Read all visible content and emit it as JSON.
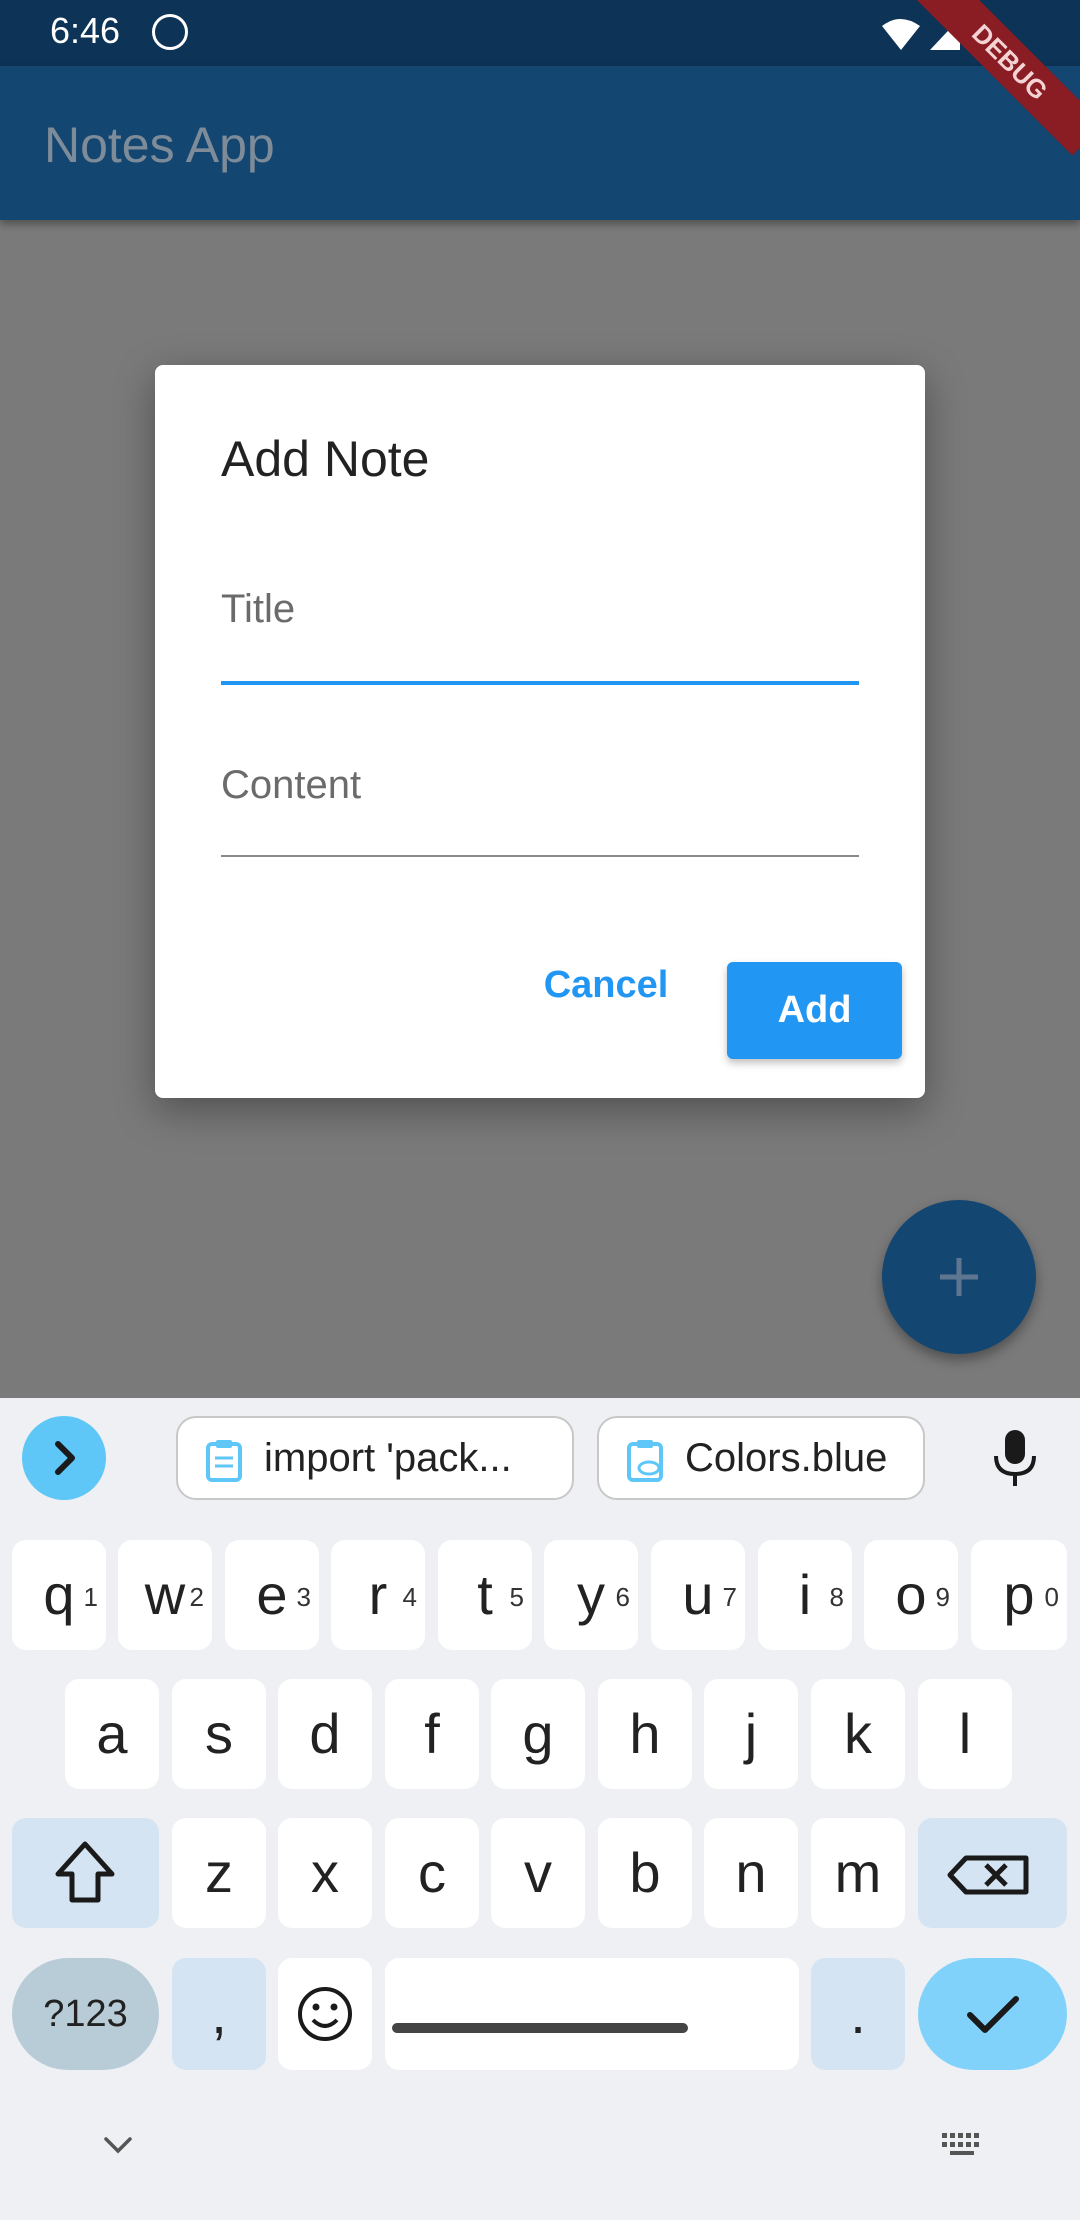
{
  "status": {
    "time": "6:46"
  },
  "appbar": {
    "title": "Notes App",
    "debug": "DEBUG"
  },
  "dialog": {
    "title": "Add Note",
    "title_placeholder": "Title",
    "content_placeholder": "Content",
    "cancel": "Cancel",
    "add": "Add"
  },
  "fab": {
    "icon": "plus-icon"
  },
  "keyboard": {
    "suggestions": [
      "import 'pack...",
      "Colors.blue"
    ],
    "row1": [
      {
        "k": "q",
        "n": "1"
      },
      {
        "k": "w",
        "n": "2"
      },
      {
        "k": "e",
        "n": "3"
      },
      {
        "k": "r",
        "n": "4"
      },
      {
        "k": "t",
        "n": "5"
      },
      {
        "k": "y",
        "n": "6"
      },
      {
        "k": "u",
        "n": "7"
      },
      {
        "k": "i",
        "n": "8"
      },
      {
        "k": "o",
        "n": "9"
      },
      {
        "k": "p",
        "n": "0"
      }
    ],
    "row2": [
      "a",
      "s",
      "d",
      "f",
      "g",
      "h",
      "j",
      "k",
      "l"
    ],
    "row3": [
      "z",
      "x",
      "c",
      "v",
      "b",
      "n",
      "m"
    ],
    "sym": "?123",
    "comma": ",",
    "period": "."
  },
  "colors": {
    "accent": "#2196f3",
    "appbar": "#144672",
    "scrim": "#7a7a7a"
  }
}
